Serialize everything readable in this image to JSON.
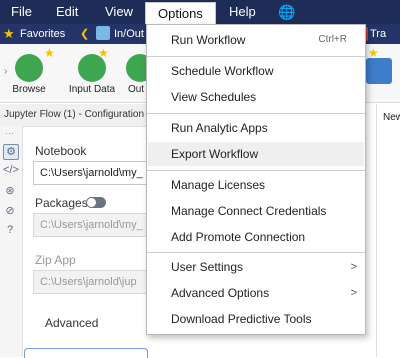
{
  "menubar": {
    "file": "File",
    "edit": "Edit",
    "view": "View",
    "options": "Options",
    "help": "Help"
  },
  "favorites": {
    "label": "Favorites",
    "tab1": "In/Out",
    "tab2": "Tra"
  },
  "ribbon": {
    "browse": "Browse",
    "input_data": "Input Data",
    "out": "Out"
  },
  "config": {
    "title": "Jupyter Flow (1) - Configuration",
    "notebook_label": "Notebook",
    "notebook_value": "C:\\Users\\jarnold\\my_",
    "packages_label": "Packages",
    "packages_value": "C:\\Users\\jarnold\\my_",
    "zip_label": "Zip App",
    "zip_value": "C:\\Users\\jarnold\\jup",
    "advanced_label": "Advanced"
  },
  "right_pane": {
    "tab": "New"
  },
  "menu": {
    "run_workflow": "Run Workflow",
    "run_shortcut": "Ctrl+R",
    "schedule_workflow": "Schedule Workflow",
    "view_schedules": "View Schedules",
    "run_analytic_apps": "Run Analytic Apps",
    "export_workflow": "Export Workflow",
    "manage_licenses": "Manage Licenses",
    "manage_connect": "Manage Connect Credentials",
    "add_promote": "Add Promote Connection",
    "user_settings": "User Settings",
    "advanced_options": "Advanced Options",
    "download_predictive": "Download Predictive Tools",
    "submenu_arrow": ">"
  },
  "colors": {
    "menubar": "#1e2d58",
    "highlight": "#efefef",
    "star": "#f4c300"
  }
}
